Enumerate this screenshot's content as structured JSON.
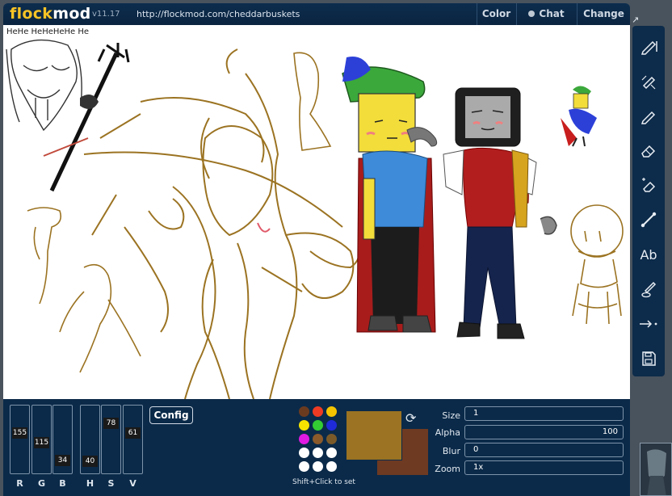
{
  "header": {
    "logo_part1": "flock",
    "logo_part2": "mod",
    "version": "v11.17",
    "url": "http://flockmod.com/cheddarbuskets",
    "menu": [
      "Color",
      "Chat",
      "Change"
    ]
  },
  "canvas": {
    "scribble_text": "HeHe HeHeHeHe He"
  },
  "tools": [
    "pencil-icon",
    "brush-icon",
    "pen-icon",
    "eraser-icon",
    "soft-eraser-icon",
    "line-icon",
    "text-icon",
    "eyedropper-icon",
    "transform-icon",
    "save-icon"
  ],
  "tool_text_label": "Ab",
  "sliders": {
    "R": {
      "label": "R",
      "value": "155",
      "fraction": 0.61
    },
    "G": {
      "label": "G",
      "value": "115",
      "fraction": 0.45
    },
    "B": {
      "label": "B",
      "value": "34",
      "fraction": 0.13
    },
    "H": {
      "label": "H",
      "value": "40",
      "fraction": 0.11
    },
    "S": {
      "label": "S",
      "value": "78",
      "fraction": 0.78
    },
    "V": {
      "label": "V",
      "value": "61",
      "fraction": 0.61
    }
  },
  "config_label": "Config",
  "palette": [
    "#6b3b1f",
    "#ef3b23",
    "#f5c400",
    "#f5e400",
    "#33cc33",
    "#1f2bd8",
    "#e01ae0",
    "#8a5a2b",
    "#7b5a2a",
    "#ffffff",
    "#ffffff",
    "#ffffff",
    "#ffffff",
    "#ffffff",
    "#ffffff"
  ],
  "palette_hint": "Shift+Click to set",
  "colors": {
    "primary": "#9b7322",
    "secondary": "#6e3a22",
    "topbar": "#0d2d4e",
    "panel": "#0b2a49",
    "sketch": "#9b7322"
  },
  "properties": {
    "size": {
      "label": "Size",
      "value": "1"
    },
    "alpha": {
      "label": "Alpha",
      "value": "100"
    },
    "blur": {
      "label": "Blur",
      "value": "0"
    },
    "zoom": {
      "label": "Zoom",
      "value": "1x"
    }
  }
}
